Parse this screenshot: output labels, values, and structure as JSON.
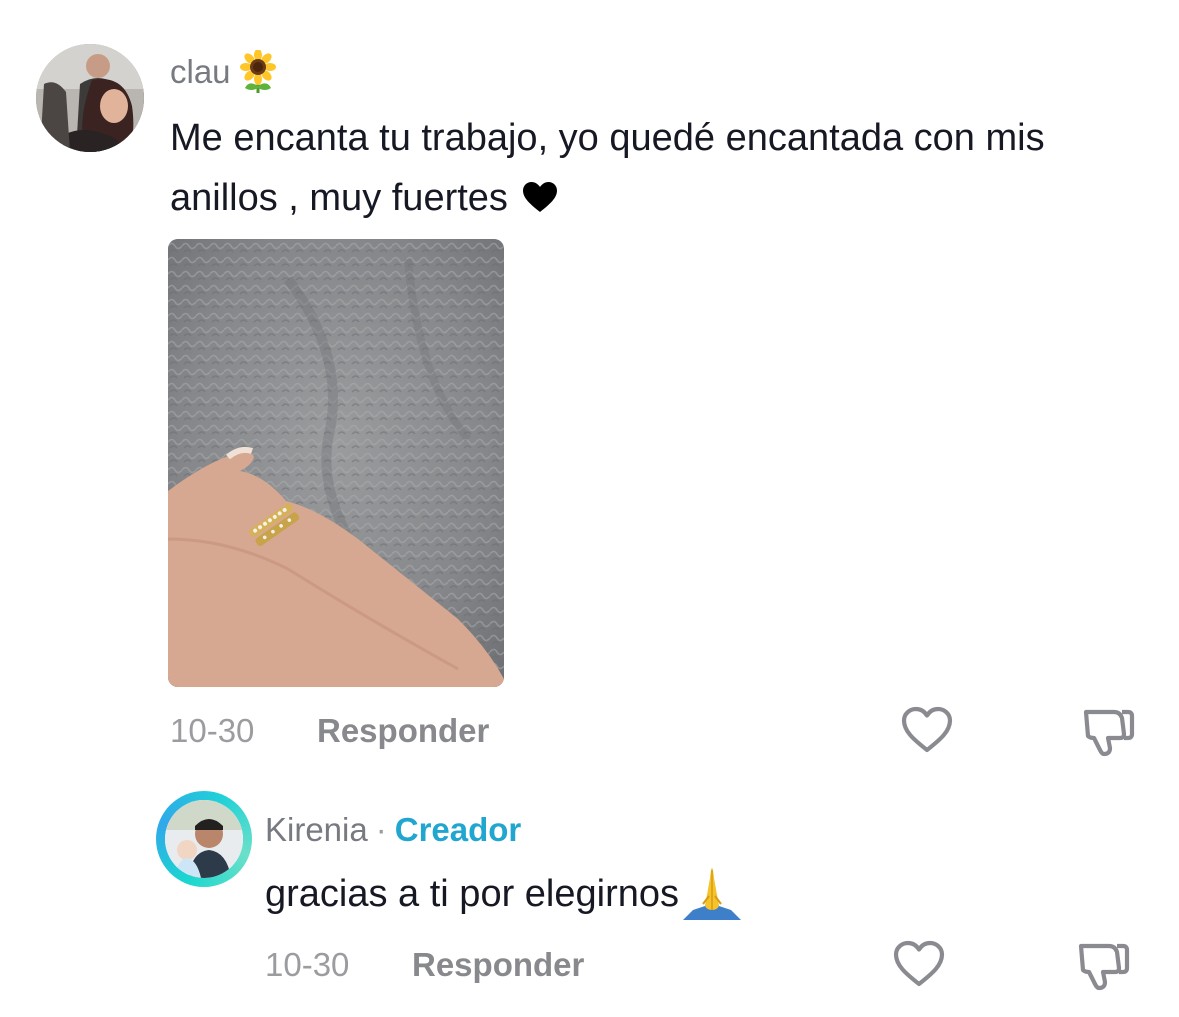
{
  "comment": {
    "username": "clau",
    "username_emoji": "sunflower-emoji",
    "text": "Me encanta tu trabajo, yo quedé encantada con mis anillos , muy fuertes",
    "text_emoji": "black-heart-emoji",
    "date": "10-30",
    "reply_label": "Responder",
    "photo": "hand-with-gold-rings-on-gray-blanket"
  },
  "reply": {
    "username": "Kirenia",
    "separator": "·",
    "badge": "Creador",
    "text": "gracias a ti por elegirnos",
    "text_emoji": "folded-hands-emoji",
    "date": "10-30",
    "reply_label": "Responder"
  },
  "icons": {
    "like": "heart-outline-icon",
    "dislike": "thumbs-down-icon"
  },
  "colors": {
    "text": "#161823",
    "secondary": "#777a80",
    "creator_badge": "#20a6cf"
  }
}
